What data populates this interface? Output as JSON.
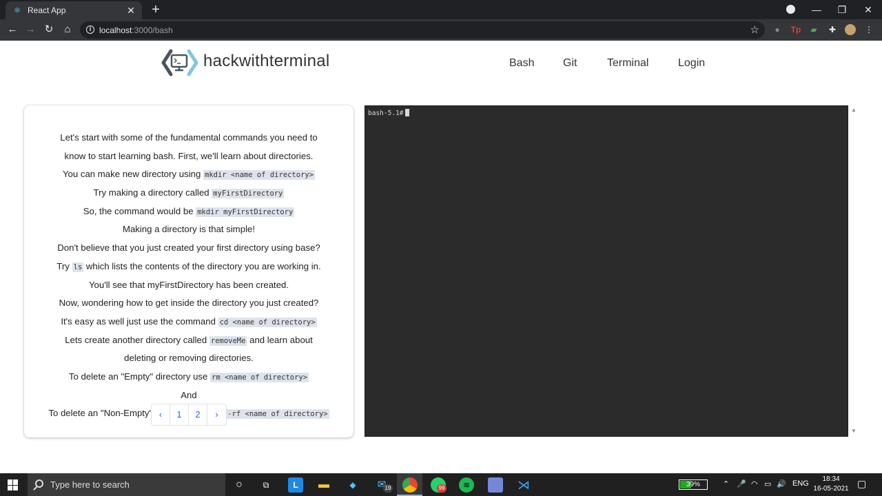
{
  "browser": {
    "tab_title": "React App",
    "url_host": "localhost",
    "url_path": ":3000/bash"
  },
  "site": {
    "brand": "hackwithterminal",
    "nav": [
      "Bash",
      "Git",
      "Terminal",
      "Login"
    ]
  },
  "lesson": {
    "lines": [
      {
        "text": "Let's start with some of the fundamental commands you need to"
      },
      {
        "text": "know to start learning bash. First, we'll learn about directories."
      },
      {
        "text": "You can make new directory using ",
        "code": "mkdir <name of directory>"
      },
      {
        "text": "Try making a directory called ",
        "code": "myFirstDirectory"
      },
      {
        "text": "So, the command would be ",
        "code": "mkdir myFirstDirectory"
      },
      {
        "text": "Making a directory is that simple!"
      },
      {
        "text": "Don't believe that you just created your first directory using base?"
      },
      {
        "text": "Try ",
        "code": "ls",
        "after": " which lists the contents of the directory you are working in."
      },
      {
        "text": "You'll see that myFirstDirectory has been created."
      },
      {
        "text": "Now, wondering how to get inside the directory you just created?"
      },
      {
        "text": "It's easy as well just use the command ",
        "code": "cd <name of directory>"
      },
      {
        "text": "Lets create another directory called ",
        "code": "removeMe",
        "after": " and learn about"
      },
      {
        "text": "deleting or removing directories."
      },
      {
        "text": "To delete an \"Empty\" directory use ",
        "code": "rm <name of directory>"
      },
      {
        "text": "And"
      },
      {
        "text": "To delete an \"Non-Empty\"",
        "code": "-rf <name of directory>",
        "pad": true
      }
    ],
    "pagination": [
      "‹",
      "1",
      "2",
      "›"
    ]
  },
  "terminal": {
    "prompt": "bash-5.1#"
  },
  "taskbar": {
    "search_placeholder": "Type here to search",
    "battery": "39%",
    "lang": "ENG",
    "time": "18:34",
    "date": "16-05-2021",
    "mail_badge": "19",
    "whatsapp_badge": "99"
  }
}
